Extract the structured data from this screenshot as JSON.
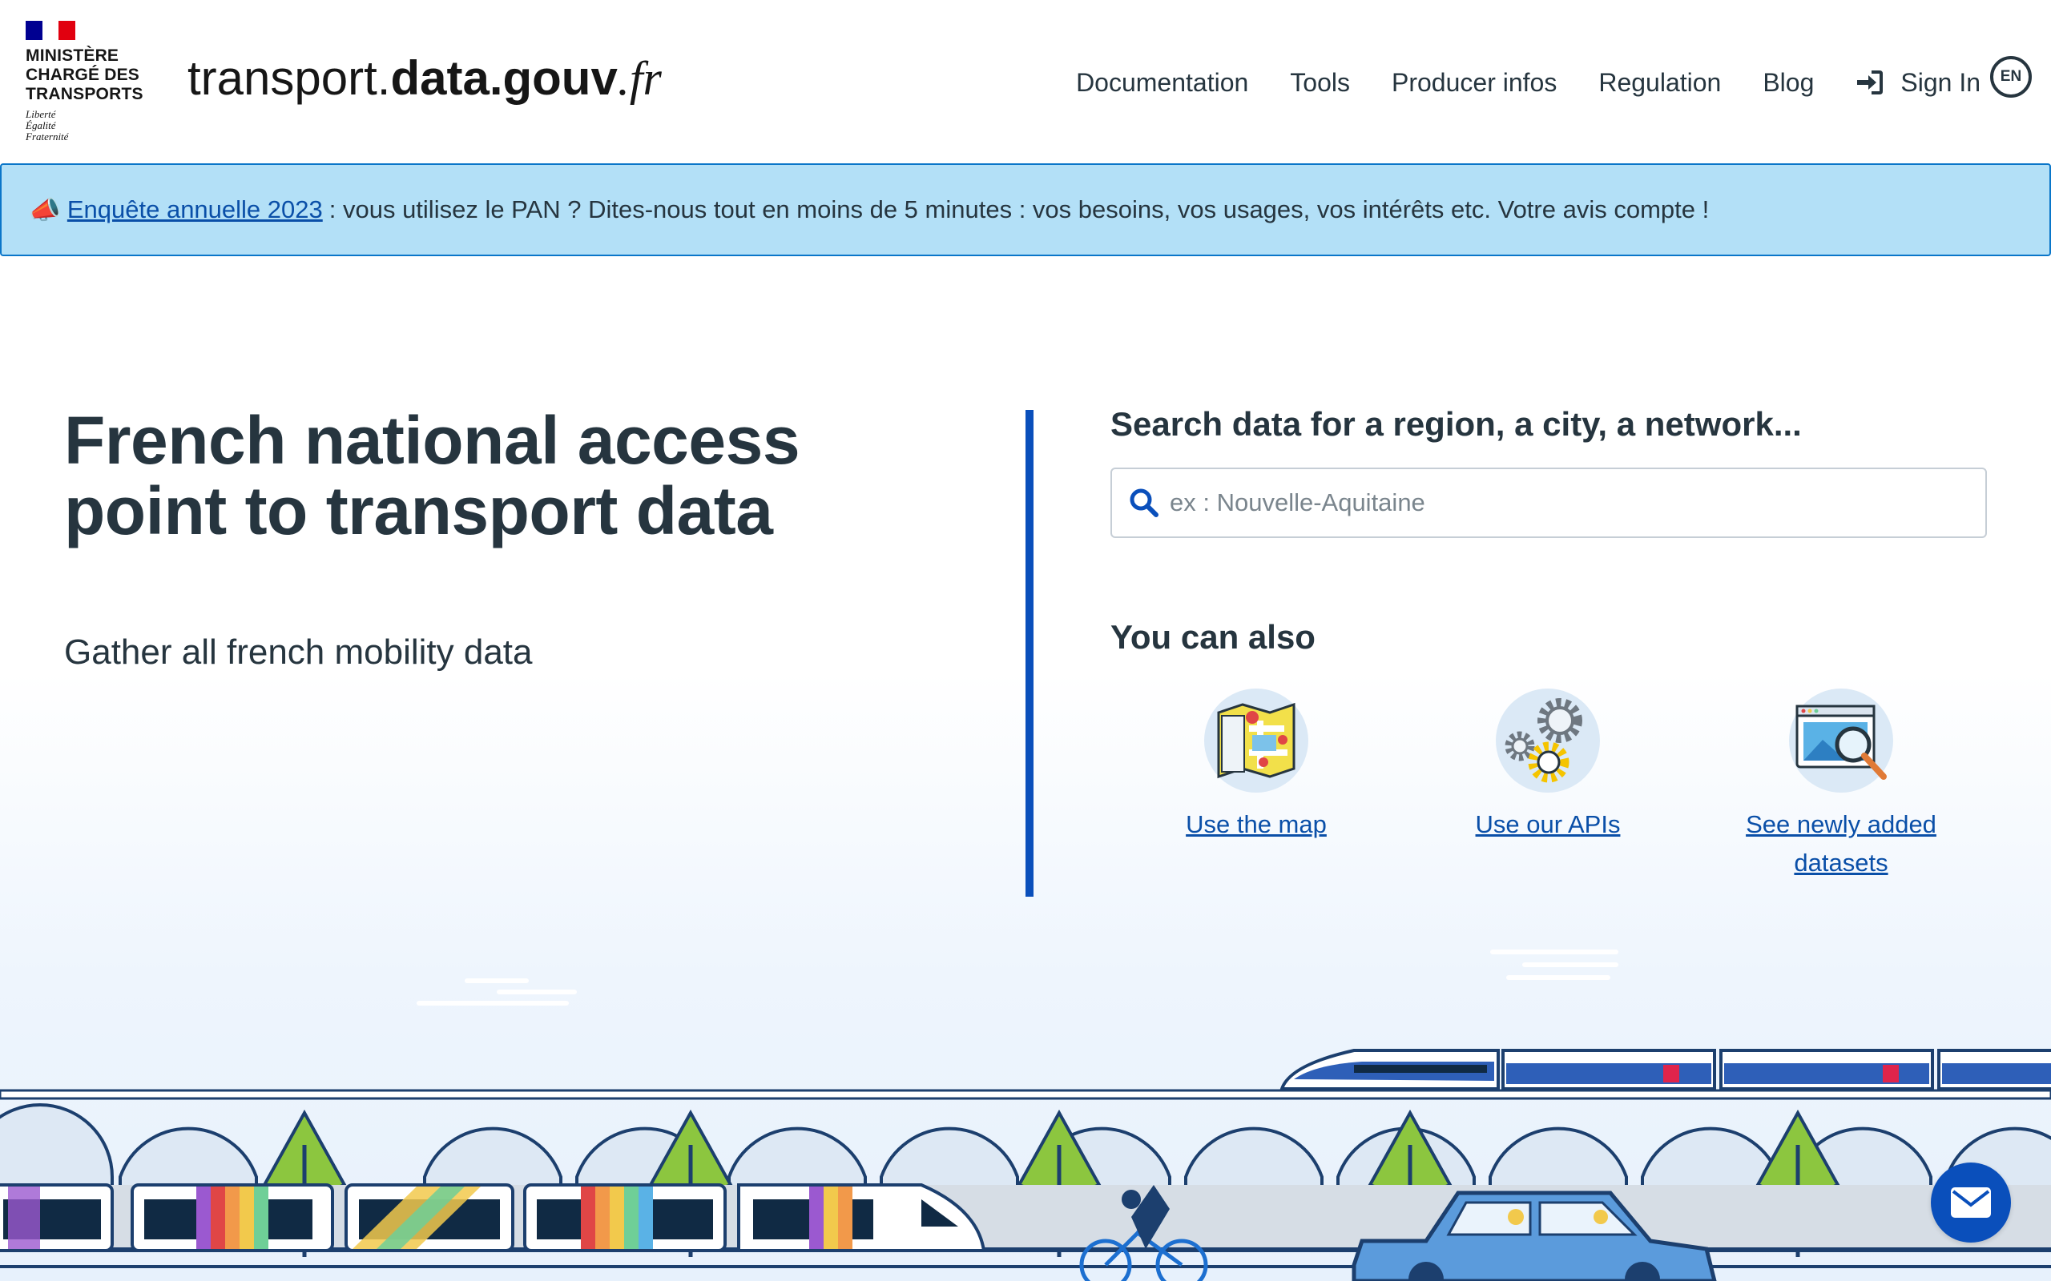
{
  "header": {
    "ministry_lines": [
      "MINISTÈRE",
      "CHARGÉ DES",
      "TRANSPORTS"
    ],
    "motto_lines": [
      "Liberté",
      "Égalité",
      "Fraternité"
    ],
    "site_name_part1": "transport.",
    "site_name_part2": "data.gouv",
    "site_name_part3": ".fr",
    "nav": {
      "documentation": "Documentation",
      "tools": "Tools",
      "producer_infos": "Producer infos",
      "regulation": "Regulation",
      "blog": "Blog",
      "sign_in": "Sign In"
    },
    "language": "EN"
  },
  "banner": {
    "icon": "megaphone-icon",
    "link_text": "Enquête annuelle 2023",
    "text": ": vous utilisez le PAN ? Dites-nous tout en moins de 5 minutes : vos besoins, vos usages, vos intérêts etc. Votre avis compte !",
    "background_color": "#b3e0f7",
    "border_color": "#0a76c9"
  },
  "hero": {
    "title": "French national access point to transport data",
    "subtitle": "Gather all french mobility data"
  },
  "search": {
    "title": "Search data for a region, a city, a network...",
    "placeholder": "ex : Nouvelle-Aquitaine"
  },
  "also": {
    "title": "You can also",
    "items": [
      {
        "label": "Use the map",
        "icon": "map-icon"
      },
      {
        "label": "Use our APIs",
        "icon": "gears-icon"
      },
      {
        "label": "See newly added datasets",
        "icon": "dataset-search-icon"
      }
    ]
  },
  "chat": {
    "icon": "envelope-icon"
  },
  "colors": {
    "accent": "#0a4fbb",
    "text": "#26353f",
    "link": "#0a4fa8"
  }
}
